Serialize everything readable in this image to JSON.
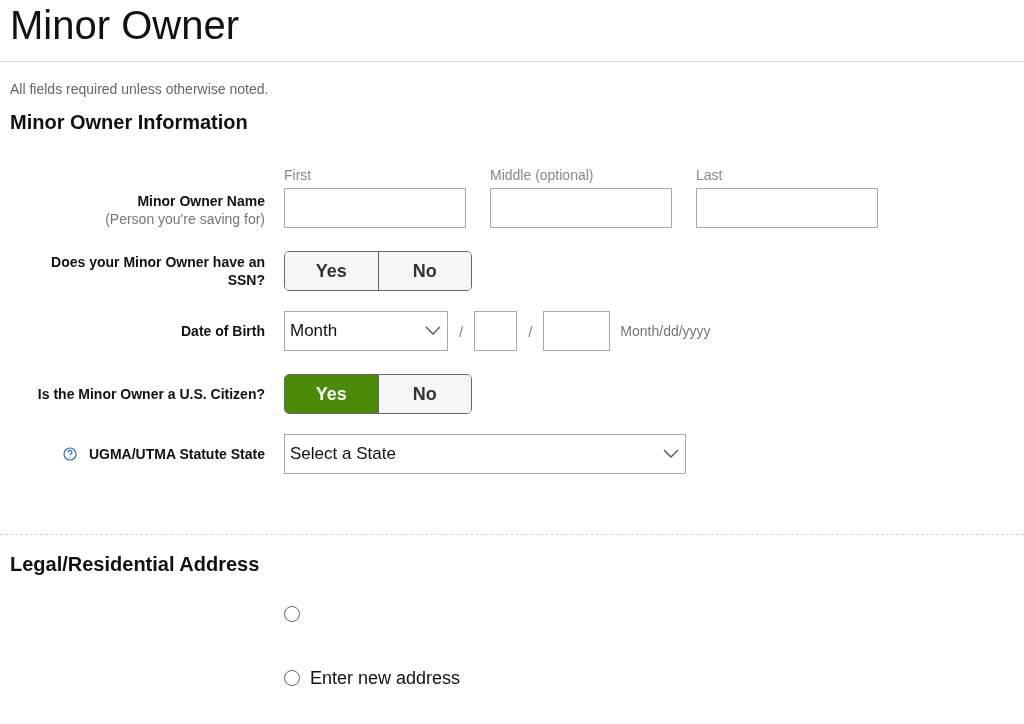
{
  "page": {
    "title": "Minor Owner",
    "note": "All fields required unless otherwise noted."
  },
  "minor_owner_information": {
    "heading": "Minor Owner Information",
    "name": {
      "label": "Minor Owner Name",
      "sublabel": "(Person you're saving for)",
      "fields": [
        {
          "caption": "First"
        },
        {
          "caption": "Middle (optional)"
        },
        {
          "caption": "Last"
        }
      ]
    },
    "has_ssn": {
      "label": "Does your Minor Owner have an SSN?",
      "options": [
        {
          "label": "Yes",
          "selected": false
        },
        {
          "label": "No",
          "selected": false
        }
      ]
    },
    "date_of_birth": {
      "label": "Date of Birth",
      "month": "Month",
      "separators": [
        "/",
        "/"
      ],
      "format_hint": "Month/dd/yyyy"
    },
    "us_citizen": {
      "label": "Is the Minor Owner a U.S. Citizen?",
      "options": [
        {
          "label": "Yes",
          "selected": true
        },
        {
          "label": "No",
          "selected": false
        }
      ]
    },
    "statute_state": {
      "label": "UGMA/UTMA Statute State",
      "value": "Select a State"
    }
  },
  "legal_residential_address": {
    "heading": "Legal/Residential Address",
    "options": [
      {
        "selected": false
      },
      {
        "label": "Enter new address",
        "selected": false
      }
    ]
  }
}
